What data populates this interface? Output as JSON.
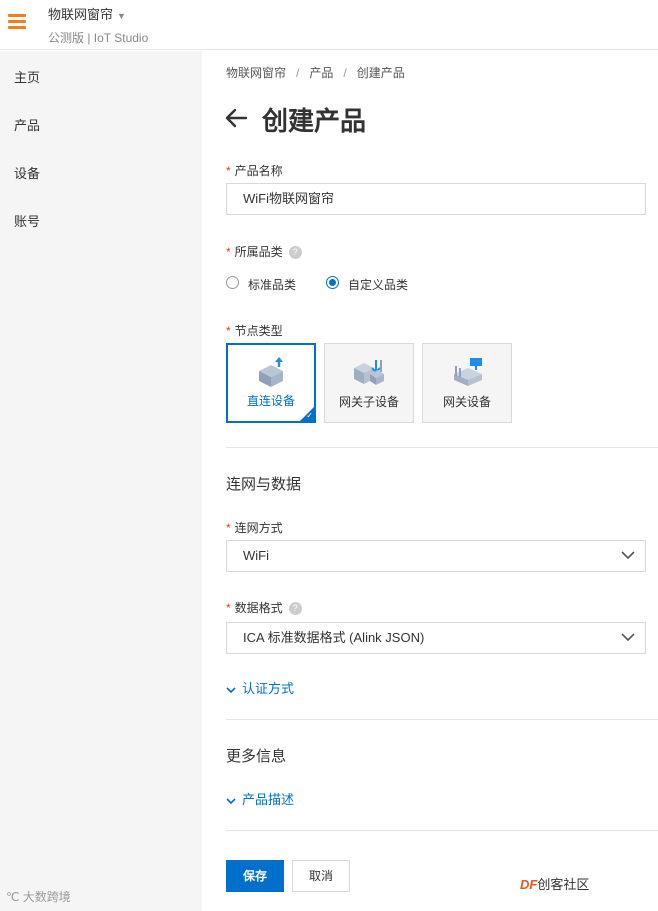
{
  "topbar": {
    "app_name": "物联网窗帘",
    "app_caret": "▼",
    "app_subtitle": "公测版 | IoT Studio"
  },
  "sidebar": {
    "items": [
      {
        "label": "主页"
      },
      {
        "label": "产品"
      },
      {
        "label": "设备"
      },
      {
        "label": "账号"
      }
    ]
  },
  "breadcrumb": {
    "items": [
      "物联网窗帘",
      "产品",
      "创建产品"
    ],
    "separator": "/"
  },
  "page": {
    "title": "创建产品"
  },
  "form": {
    "required_mark": "*",
    "help_mark": "?",
    "product_name": {
      "label": "产品名称",
      "value": "WiFi物联网窗帘"
    },
    "category": {
      "label": "所属品类",
      "options": [
        {
          "label": "标准品类",
          "selected": false
        },
        {
          "label": "自定义品类",
          "selected": true
        }
      ]
    },
    "node_type": {
      "label": "节点类型",
      "options": [
        {
          "label": "直连设备",
          "selected": true,
          "icon": "direct-device-icon"
        },
        {
          "label": "网关子设备",
          "selected": false,
          "icon": "gateway-subdevice-icon"
        },
        {
          "label": "网关设备",
          "selected": false,
          "icon": "gateway-device-icon"
        }
      ],
      "check_glyph": "✓"
    },
    "network_section": {
      "title": "连网与数据",
      "connection": {
        "label": "连网方式",
        "value": "WiFi"
      },
      "data_format": {
        "label": "数据格式",
        "value": "ICA 标准数据格式 (Alink JSON)"
      },
      "auth_link": "认证方式"
    },
    "more_section": {
      "title": "更多信息",
      "description_link": "产品描述"
    }
  },
  "actions": {
    "save": "保存",
    "cancel": "取消"
  },
  "watermarks": {
    "left": "℃ 大数跨境",
    "right_prefix": "DF",
    "right_suffix": "创客社区"
  },
  "colors": {
    "accent": "#0070cc",
    "hamburger": "#f27f1b",
    "required": "#e0401b",
    "sidebar_bg": "#f5f5f5"
  }
}
